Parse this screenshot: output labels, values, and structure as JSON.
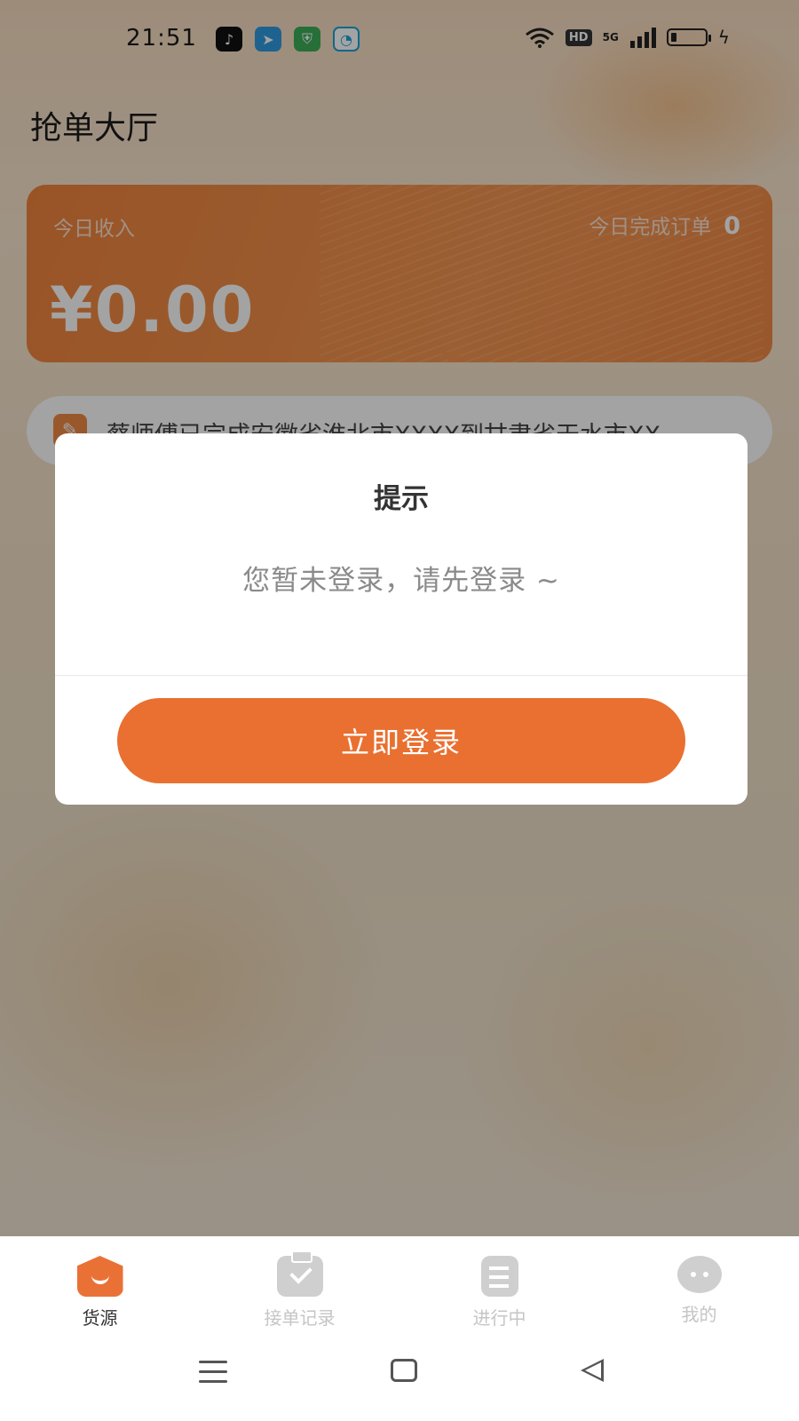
{
  "status_bar": {
    "time": "21:51",
    "notification_icons": [
      "tiktok-icon",
      "telegram-icon",
      "shield-app-icon",
      "chat-app-icon"
    ],
    "network": "5G",
    "hd": "HD",
    "charging": true
  },
  "header": {
    "title": "抢单大厅"
  },
  "income_card": {
    "today_income_label": "今日收入",
    "today_orders_label": "今日完成订单",
    "today_orders_count": "0",
    "income_amount": "¥0.00"
  },
  "ticker": {
    "icon": "announcement-icon",
    "text": "蔡师傅已完成安徽省淮北市XXXX到甘肃省天水市XX"
  },
  "dialog": {
    "title": "提示",
    "message": "您暂未登录，请先登录 ~",
    "button_label": "立即登录"
  },
  "tab_bar": {
    "tabs": [
      {
        "label": "货源",
        "icon": "home-box-icon",
        "active": true
      },
      {
        "label": "接单记录",
        "icon": "clipboard-check-icon",
        "active": false
      },
      {
        "label": "进行中",
        "icon": "document-progress-icon",
        "active": false
      },
      {
        "label": "我的",
        "icon": "chat-bubble-icon",
        "active": false
      }
    ]
  },
  "colors": {
    "accent": "#e97030",
    "card": "#f08a45"
  }
}
